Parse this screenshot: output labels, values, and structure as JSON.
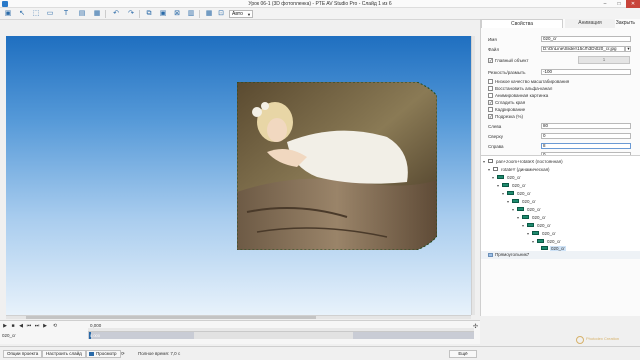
{
  "window": {
    "title": "Урок 06-1 (3D фотопленка) - PTE AV Studio Pro - Слайд 1 из 6"
  },
  "toolbar": {
    "zoom_value": "Авто"
  },
  "properties_panel": {
    "tab_properties": "Свойства",
    "tab_animation": "Анимация",
    "close_button": "Закрыть",
    "name_label": "Имя",
    "name_value": "020_cr",
    "file_label": "Файл",
    "file_value": "D:\\OnLine\\Slider\\15сЛ\\3D\\020_cr.jpg",
    "main_object_label": "Главный объект",
    "main_object_checked": true,
    "main_object_value": "1",
    "radius_label": "Резкость/размыть",
    "radius_value": "-100",
    "options": [
      {
        "label": "Низкое качество масштабирования",
        "checked": false
      },
      {
        "label": "Восстановить альфа-канал",
        "checked": false
      },
      {
        "label": "Анимированная картинка",
        "checked": false
      },
      {
        "label": "Сгладить края",
        "checked": true
      },
      {
        "label": "Кадрирование",
        "checked": false
      },
      {
        "label": "Подрезка (%)",
        "checked": true
      }
    ],
    "left_label": "Слева",
    "left_value": "80",
    "top_label": "Сверху",
    "top_value": "0",
    "right_label": "Справа",
    "right_value": "8",
    "bottom_value": "0"
  },
  "tree": {
    "items": [
      {
        "label": "pan+zoom+rotateX (постоянная)",
        "level": 0,
        "icon": "frame"
      },
      {
        "label": "rotateY (динамическая)",
        "level": 1,
        "icon": "frame"
      },
      {
        "label": "020_cr",
        "level": 2,
        "icon": "image"
      },
      {
        "label": "020_cr",
        "level": 3,
        "icon": "image"
      },
      {
        "label": "020_cr",
        "level": 4,
        "icon": "image"
      },
      {
        "label": "020_cr",
        "level": 5,
        "icon": "image"
      },
      {
        "label": "020_cr",
        "level": 6,
        "icon": "image"
      },
      {
        "label": "020_cr",
        "level": 7,
        "icon": "image"
      },
      {
        "label": "020_cr",
        "level": 8,
        "icon": "image"
      },
      {
        "label": "020_cr",
        "level": 9,
        "icon": "image"
      },
      {
        "label": "020_cr",
        "level": 10,
        "icon": "image"
      },
      {
        "label": "020_cr",
        "level": 11,
        "icon": "image",
        "selected": true
      }
    ],
    "mask_label": "Прямоугольник7"
  },
  "timeline": {
    "time": "0,000",
    "track_label": "020_cr",
    "marker": "0,000"
  },
  "bottombar": {
    "project_options": "Опции проекта",
    "slide_settings": "Настроить слайд",
    "preview": "Просмотр",
    "full_time": "Полное время: 7,0 с",
    "hide": "Ещё"
  },
  "watermark": {
    "line1": "Photodex Creation"
  },
  "colors": {
    "accent": "#2a6aa8",
    "stage_top": "#1f6fc0",
    "stage_bottom": "#e8f2fb",
    "tree_icon": "#1f8a6e",
    "close_red": "#c8443a"
  }
}
